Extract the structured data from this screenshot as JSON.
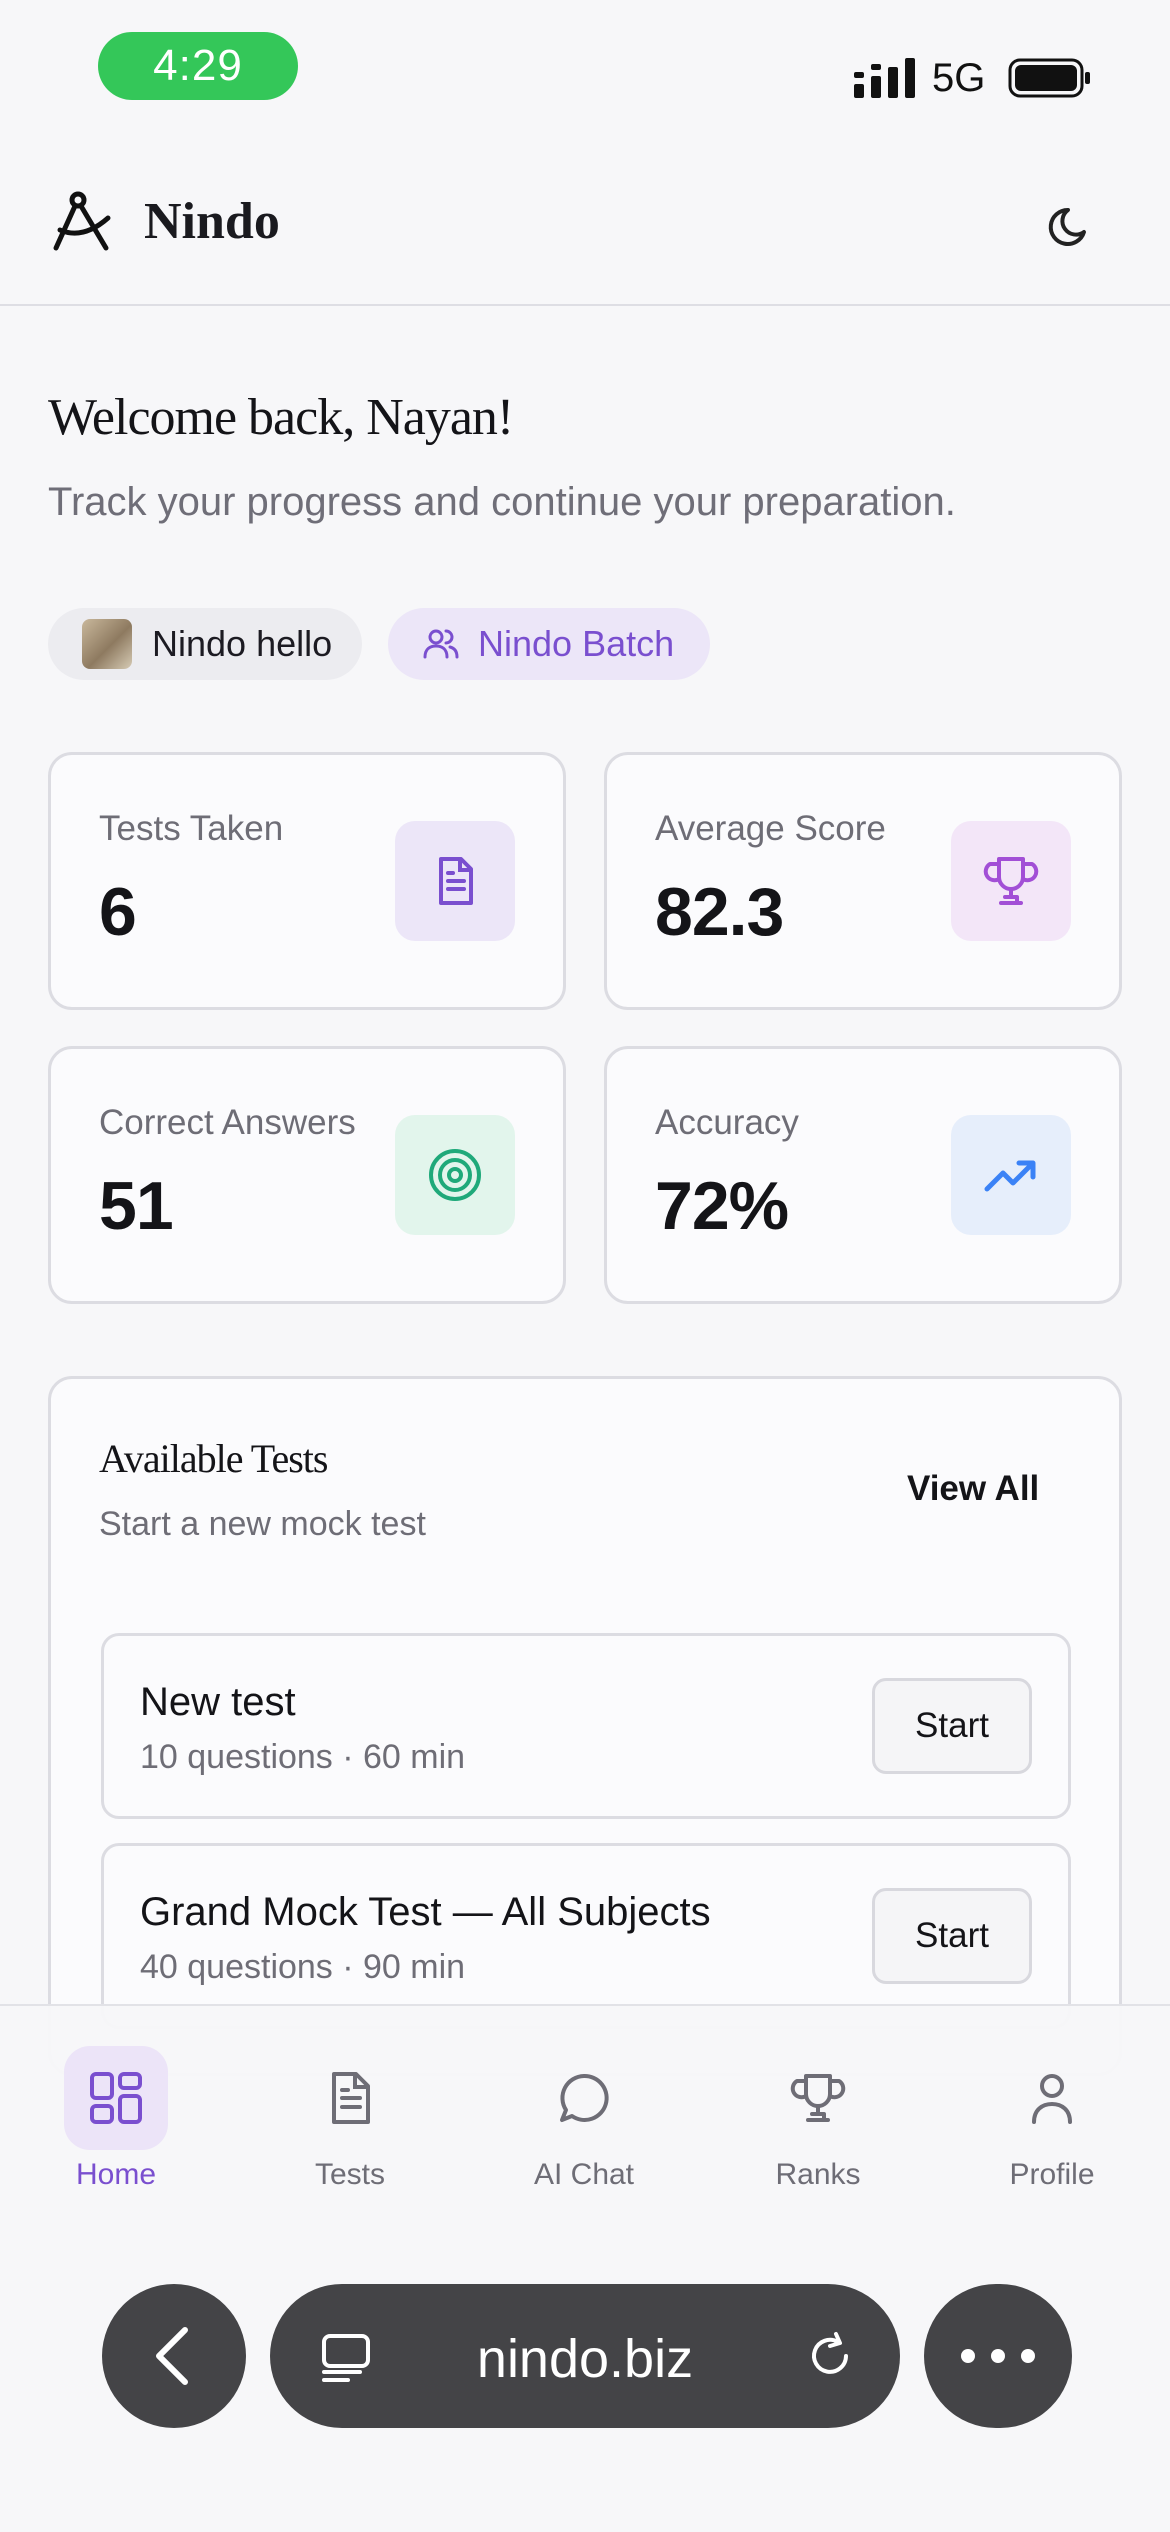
{
  "status_bar": {
    "time": "4:29",
    "network": "5G"
  },
  "header": {
    "brand": "Nindo"
  },
  "welcome": {
    "title": "Welcome back, Nayan!",
    "subtitle": "Track your progress and continue your preparation."
  },
  "chips": {
    "user": "Nindo hello",
    "batch": "Nindo Batch"
  },
  "stats": [
    {
      "label": "Tests Taken",
      "value": "6",
      "icon": "document-icon",
      "color": "#7a4fcf"
    },
    {
      "label": "Average Score",
      "value": "82.3",
      "icon": "trophy-icon",
      "color": "#a24fd6"
    },
    {
      "label": "Correct Answers",
      "value": "51",
      "icon": "target-icon",
      "color": "#1fa97a"
    },
    {
      "label": "Accuracy",
      "value": "72%",
      "icon": "trending-up-icon",
      "color": "#3b82f6"
    }
  ],
  "tests_section": {
    "title": "Available Tests",
    "subtitle": "Start a new mock test",
    "view_all": "View All",
    "items": [
      {
        "name": "New test",
        "meta": "10 questions · 60 min",
        "action": "Start"
      },
      {
        "name": "Grand Mock Test — All Subjects",
        "meta": "40 questions · 90 min",
        "action": "Start"
      }
    ]
  },
  "nav": [
    {
      "label": "Home",
      "icon": "grid-icon",
      "active": true
    },
    {
      "label": "Tests",
      "icon": "document-icon"
    },
    {
      "label": "AI Chat",
      "icon": "chat-icon"
    },
    {
      "label": "Ranks",
      "icon": "trophy-icon"
    },
    {
      "label": "Profile",
      "icon": "user-icon"
    }
  ],
  "browser": {
    "url": "nindo.biz"
  },
  "colors": {
    "accent": "#7a4fcf",
    "status_green": "#34c759"
  }
}
